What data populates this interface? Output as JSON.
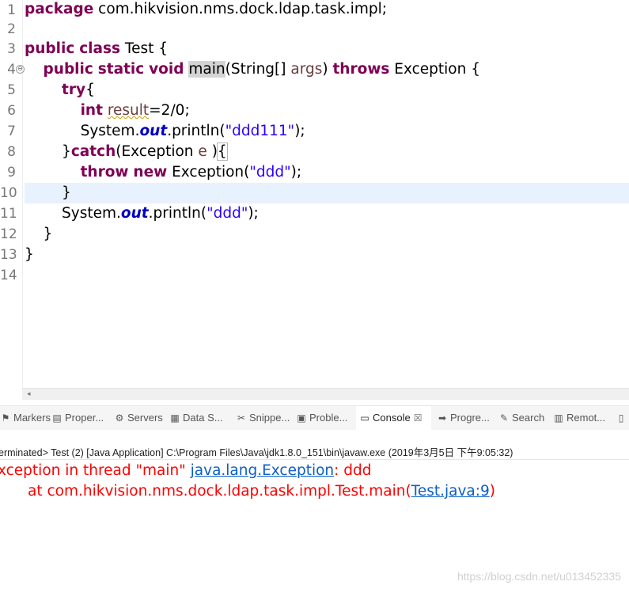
{
  "editor": {
    "line_numbers": [
      "1",
      "2",
      "3",
      "4",
      "5",
      "6",
      "7",
      "8",
      "9",
      "10",
      "11",
      "12",
      "13",
      "14"
    ],
    "fold_marker": "⊖",
    "lines": {
      "l1": {
        "kw1": "package",
        "rest": " com.hikvision.nms.dock.ldap.task.impl;"
      },
      "l3": {
        "kw1": "public",
        "kw2": "class",
        "rest": " Test {"
      },
      "l4": {
        "kw1": "public",
        "kw2": "static",
        "kw3": "void",
        "method": "main",
        "p1": "(String[] ",
        "param": "args",
        "p2": ") ",
        "kw4": "throws",
        "rest": " Exception {"
      },
      "l5": {
        "kw1": "try",
        "rest": "{"
      },
      "l6": {
        "kw1": "int",
        "var": "result",
        "rest": "=2/0;"
      },
      "l7": {
        "pre": "System.",
        "field": "out",
        "mid": ".println(",
        "str": "\"ddd111\"",
        "post": ");"
      },
      "l8": {
        "pre": "}",
        "kw1": "catch",
        "mid": "(Exception ",
        "var": "e",
        "post": " )",
        "brace": "{"
      },
      "l9": {
        "kw1": "throw",
        "kw2": "new",
        "mid": " Exception(",
        "str": "\"ddd\"",
        "post": ");"
      },
      "l10": {
        "text": "}"
      },
      "l11": {
        "pre": "System.",
        "field": "out",
        "mid": ".println(",
        "str": "\"ddd\"",
        "post": ");"
      },
      "l12": {
        "text": "}"
      },
      "l13": {
        "text": "}"
      }
    },
    "scroll_arrow": "◂"
  },
  "tabs": [
    {
      "icon": "⚑",
      "label": "Markers"
    },
    {
      "icon": "▤",
      "label": "Proper..."
    },
    {
      "icon": "⚙",
      "label": "Servers"
    },
    {
      "icon": "▦",
      "label": "Data S..."
    },
    {
      "icon": "✂",
      "label": "Snippe..."
    },
    {
      "icon": "▣",
      "label": "Proble..."
    },
    {
      "icon": "▭",
      "label": "Console",
      "close": "☒"
    },
    {
      "icon": "➡",
      "label": "Progre..."
    },
    {
      "icon": "✎",
      "label": "Search"
    },
    {
      "icon": "▥",
      "label": "Remot..."
    },
    {
      "icon": "▯",
      "label": ""
    }
  ],
  "console": {
    "header": "erminated> Test (2) [Java Application] C:\\Program Files\\Java\\jdk1.8.0_151\\bin\\javaw.exe (2019年3月5日 下午9:05:32)",
    "line1_pre": "xception in thread \"main\" ",
    "line1_link": "java.lang.Exception",
    "line1_post": ": ddd",
    "line2_pre": "at com.hikvision.nms.dock.ldap.task.impl.Test.main(",
    "line2_link": "Test.java:9",
    "line2_post": ")",
    "watermark": "https://blog.csdn.net/u013452335"
  },
  "colors": {
    "keyword": "#7f0055",
    "string": "#2a00ff",
    "static_field": "#0000c0",
    "error": "#ff0000",
    "link": "#0b5fc6",
    "current_line": "#e8f2fe"
  }
}
